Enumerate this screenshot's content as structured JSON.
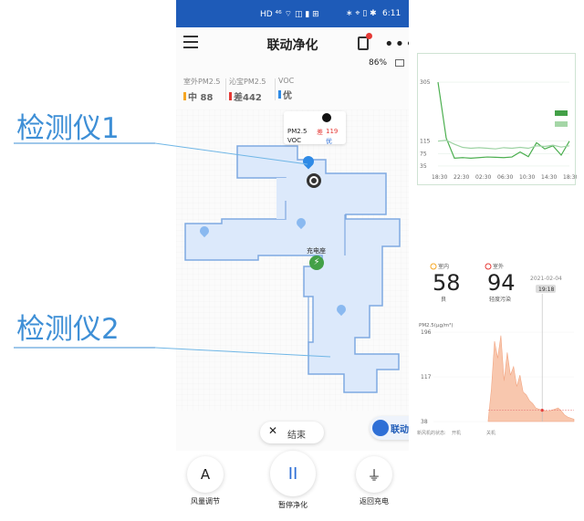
{
  "status_bar": {
    "left_icons": "HD ⁴⁶ ⌔ ◫ ▮ ⊞",
    "right_icons": "∗ ⌖ ▯ ✱",
    "time": "6:11"
  },
  "app": {
    "title": "联动净化",
    "battery": "86%",
    "air_quality": [
      {
        "label": "室外PM2.5",
        "value": "中 88",
        "dot_color": "#f5a623"
      },
      {
        "label": "沁宝PM2.5",
        "value": "差442",
        "dot_color": "#e53935"
      },
      {
        "label": "VOC",
        "value": "优",
        "dot_color": "#2e8ae6"
      }
    ],
    "map": {
      "device_popup": {
        "pm25_label": "PM2.5",
        "pm25_value": "119",
        "pm25_grade": "差",
        "voc_label": "VOC",
        "voc_value": "优"
      },
      "dock_label": "充电座"
    },
    "end_button": "结束",
    "link_button": "联动",
    "controls": [
      {
        "label": "风量调节",
        "glyph": "A"
      },
      {
        "label": "暂停净化",
        "glyph": "II"
      },
      {
        "label": "返回充电",
        "glyph": "⏚"
      }
    ]
  },
  "annotations": {
    "detector1": "检测仪1",
    "detector2": "检测仪2"
  },
  "colors": {
    "accent": "#1e5bb8",
    "map_fill": "#dce9fb",
    "map_edge": "#7ea9e1",
    "dock": "#43a047",
    "annotation": "#3e8fd6"
  },
  "chart_data": [
    {
      "type": "line",
      "y_ticks": [
        "305",
        "115",
        "75",
        "35"
      ],
      "x_ticks": [
        "18:30",
        "22:30",
        "02:30",
        "06:30",
        "10:30",
        "14:30",
        "18:30"
      ],
      "series": [
        {
          "color": "#4caf50",
          "values": [
            305,
            125,
            60,
            62,
            60,
            62,
            64,
            63,
            62,
            64,
            80,
            65,
            110,
            90,
            100,
            70,
            115
          ]
        },
        {
          "color": "#9ed3a4",
          "values": [
            115,
            118,
            105,
            95,
            92,
            94,
            92,
            90,
            94,
            92,
            95,
            92,
            100,
            98,
            102,
            96,
            100
          ]
        }
      ],
      "legend_colors": [
        "#43a047",
        "#a5d6a7"
      ]
    },
    {
      "type": "area",
      "stats": [
        {
          "label": "室内",
          "value": "58",
          "grade": "良"
        },
        {
          "label": "室外",
          "value": "94",
          "grade": "轻度污染"
        }
      ],
      "date": "2021-02-04",
      "time_badge": "19:18",
      "unit_label": "PM2.5(μg/m³)",
      "y_ticks": [
        "196",
        "117",
        "38"
      ],
      "footer": [
        "新风机的状态:",
        "开机 ",
        "关机 "
      ],
      "values": [
        40,
        95,
        180,
        150,
        190,
        110,
        160,
        120,
        135,
        100,
        120,
        90,
        85,
        75,
        70,
        62,
        60,
        58,
        57,
        56,
        58,
        60,
        62,
        57,
        50,
        46,
        44,
        42
      ]
    }
  ]
}
